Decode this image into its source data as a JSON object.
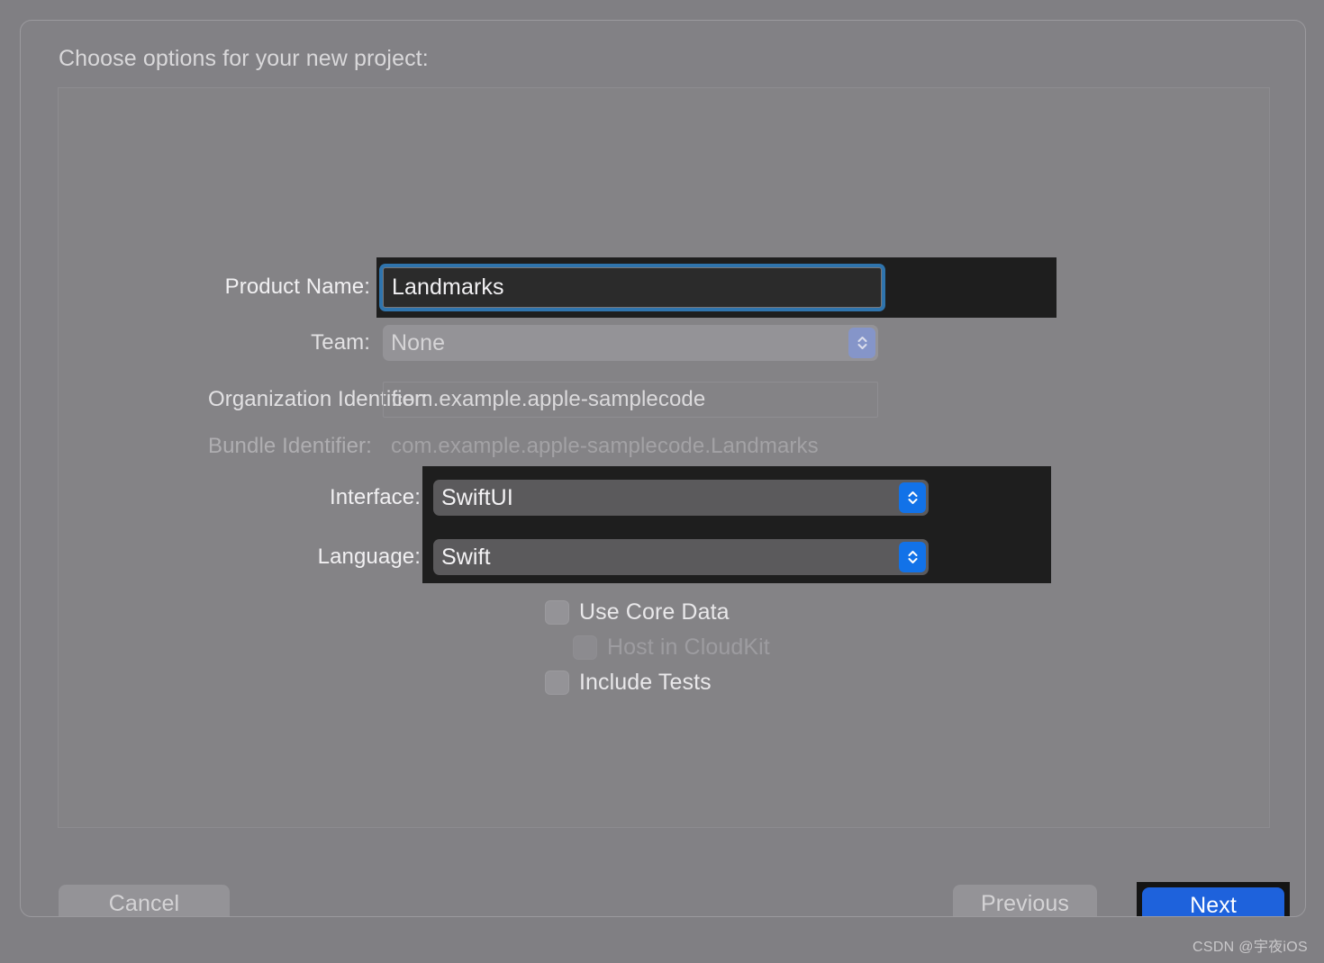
{
  "dialog": {
    "title": "Choose options for your new project:"
  },
  "form": {
    "product_name": {
      "label": "Product Name:",
      "value": "Landmarks"
    },
    "team": {
      "label": "Team:",
      "value": "None"
    },
    "organization_identifier": {
      "label": "Organization Identifier:",
      "value": "com.example.apple-samplecode"
    },
    "bundle_identifier": {
      "label": "Bundle Identifier:",
      "value": "com.example.apple-samplecode.Landmarks"
    },
    "interface": {
      "label": "Interface:",
      "value": "SwiftUI"
    },
    "language": {
      "label": "Language:",
      "value": "Swift"
    }
  },
  "checkboxes": [
    {
      "label": "Use Core Data",
      "checked": false,
      "disabled": false
    },
    {
      "label": "Host in CloudKit",
      "checked": false,
      "disabled": true
    },
    {
      "label": "Include Tests",
      "checked": false,
      "disabled": false
    }
  ],
  "footer": {
    "cancel": "Cancel",
    "previous": "Previous",
    "next": "Next"
  },
  "watermark": "CSDN @宇夜iOS",
  "colors": {
    "window_background": "#828185",
    "panel_background": "#848386",
    "focus_ring": "#2F74AD",
    "accent_blue": "#1272E8",
    "next_button_blue": "#1E62DC",
    "highlight_overlay": "#1E1E1E"
  },
  "icons": {
    "stepper": "chevron-up-down-icon"
  }
}
